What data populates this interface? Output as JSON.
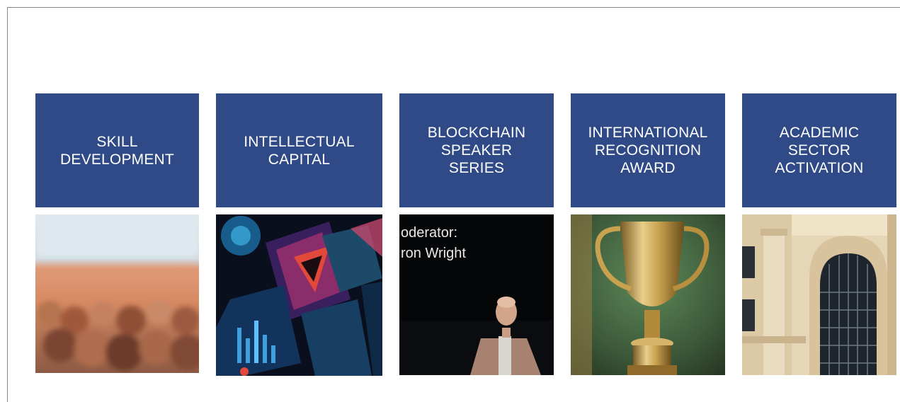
{
  "tiles": [
    {
      "lines": [
        "SKILL",
        "DEVELOPMENT"
      ]
    },
    {
      "lines": [
        "INTELLECTUAL",
        "CAPITAL"
      ]
    },
    {
      "lines": [
        "BLOCKCHAIN",
        "SPEAKER",
        "SERIES"
      ]
    },
    {
      "lines": [
        "INTERNATIONAL",
        "RECOGNITION",
        "AWARD"
      ]
    },
    {
      "lines": [
        "ACADEMIC",
        "SECTOR",
        "ACTIVATION"
      ]
    }
  ],
  "photos": [
    {
      "subject": "audience-crowd"
    },
    {
      "subject": "digital-screens"
    },
    {
      "subject": "speaker-on-stage",
      "caption_lines": [
        "oderator:",
        "ron Wright"
      ]
    },
    {
      "subject": "gold-trophy"
    },
    {
      "subject": "university-building-arch"
    }
  ],
  "colors": {
    "tile_background": "#2f4a87",
    "tile_text": "#ffffff"
  }
}
